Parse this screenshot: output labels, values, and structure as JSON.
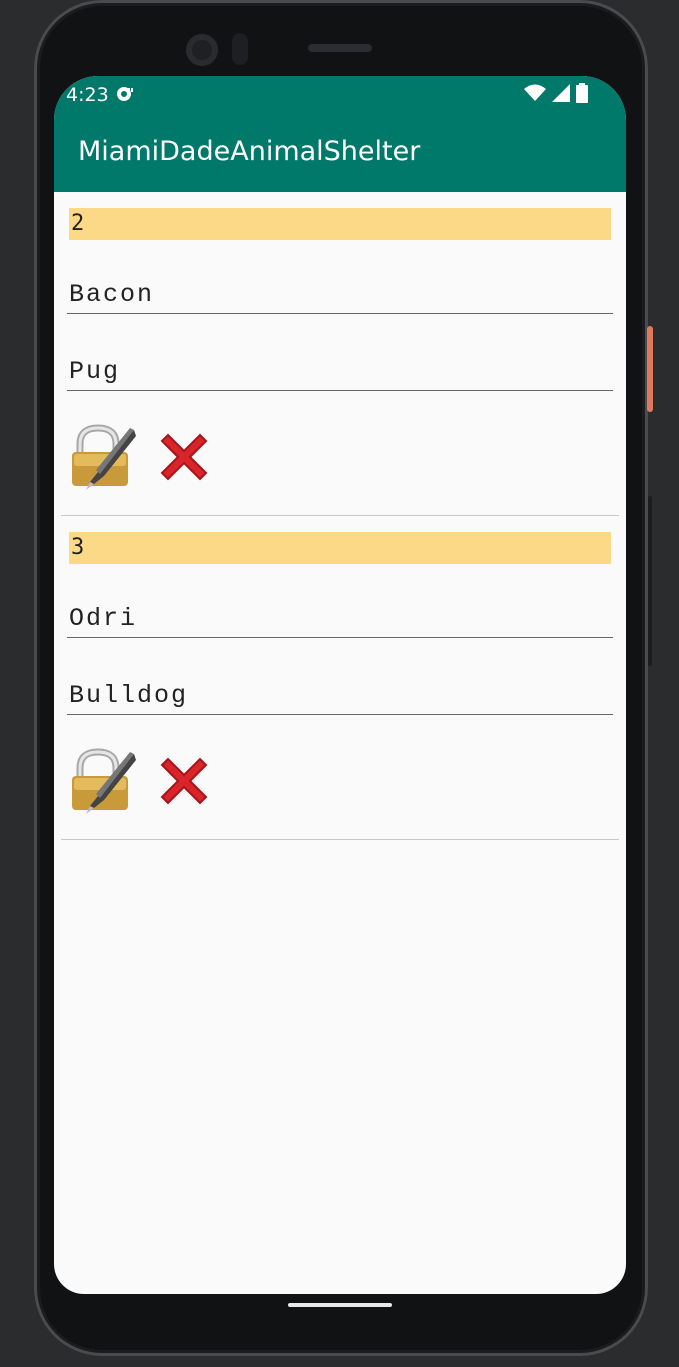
{
  "status_bar": {
    "time": "4:23"
  },
  "app_bar": {
    "title": "MiamiDadeAnimalShelter",
    "color": "#00786a"
  },
  "animals": [
    {
      "id": "2",
      "name": "Bacon",
      "breed": "Pug"
    },
    {
      "id": "3",
      "name": "Odri",
      "breed": "Bulldog"
    }
  ],
  "icons": {
    "edit": "lock-with-pen-icon",
    "delete": "red-x-icon"
  },
  "colors": {
    "id_highlight": "#fcd986",
    "delete_red": "#d9242a"
  }
}
